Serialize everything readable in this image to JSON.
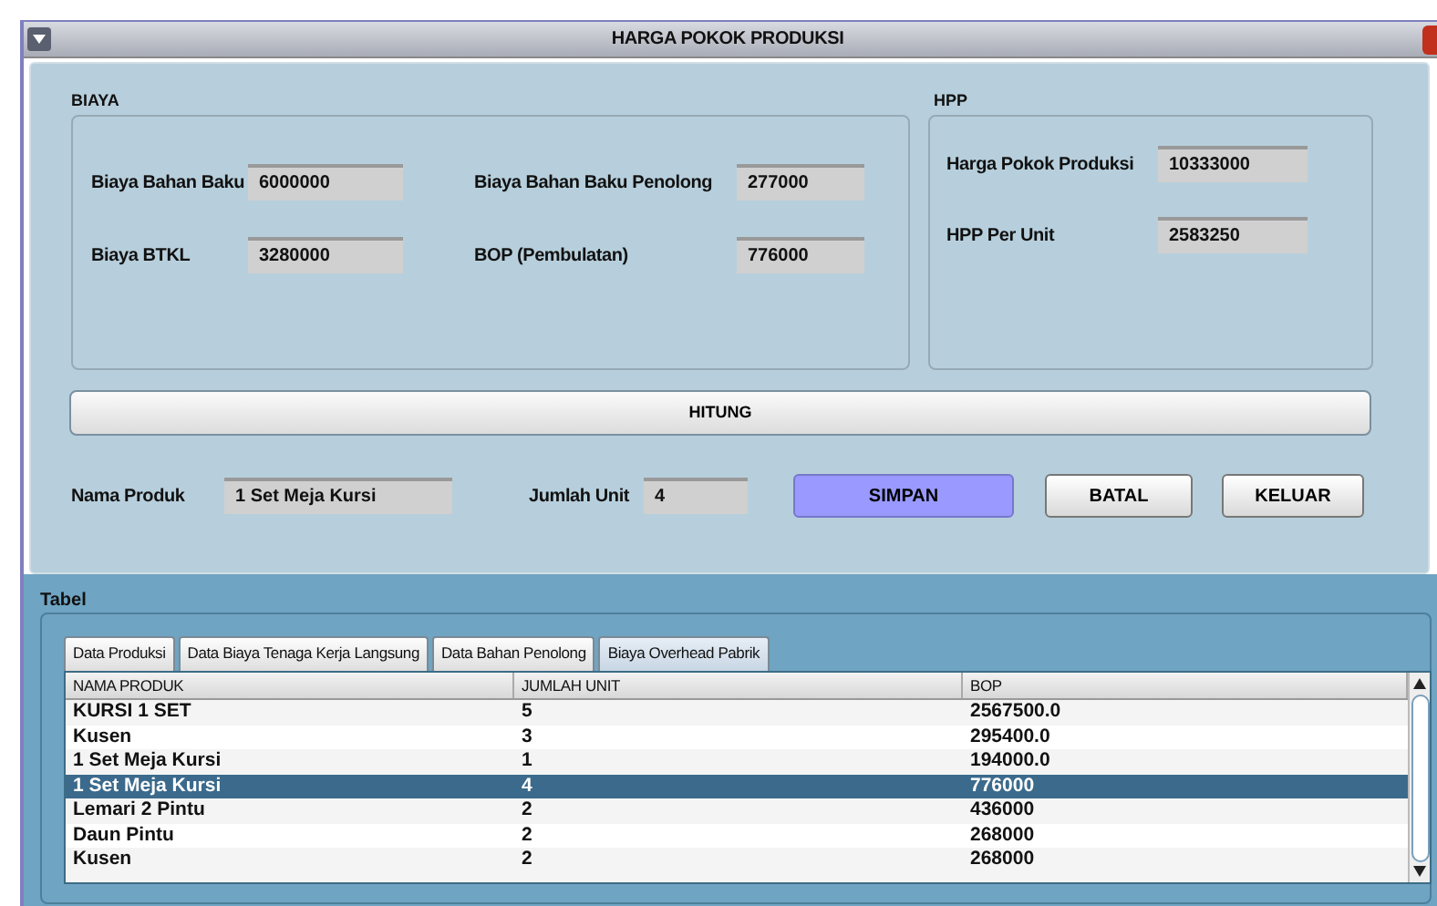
{
  "window": {
    "title": "HARGA POKOK PRODUKSI"
  },
  "biaya": {
    "title": "BIAYA",
    "fields": [
      {
        "label": "Biaya Bahan Baku",
        "value": "6000000"
      },
      {
        "label": "Biaya Bahan Baku Penolong",
        "value": "277000"
      },
      {
        "label": "Biaya BTKL",
        "value": "3280000"
      },
      {
        "label": "BOP (Pembulatan)",
        "value": "776000"
      }
    ]
  },
  "hpp": {
    "title": "HPP",
    "fields": [
      {
        "label": "Harga Pokok Produksi",
        "value": "10333000"
      },
      {
        "label": "HPP Per Unit",
        "value": "2583250"
      }
    ]
  },
  "hitung_button": "HITUNG",
  "product_fields": [
    {
      "label": "Nama Produk",
      "value": "1 Set Meja Kursi"
    },
    {
      "label": "Jumlah Unit",
      "value": "4"
    }
  ],
  "buttons": [
    {
      "label": "SIMPAN",
      "highlighted": true
    },
    {
      "label": "BATAL",
      "highlighted": false
    },
    {
      "label": "KELUAR",
      "highlighted": false
    }
  ],
  "table_panel": {
    "title": "Tabel",
    "tabs": [
      {
        "label": "Data Produksi",
        "selected": false
      },
      {
        "label": "Data Biaya Tenaga Kerja Langsung",
        "selected": false
      },
      {
        "label": "Data Bahan Penolong",
        "selected": false
      },
      {
        "label": "Biaya Overhead Pabrik",
        "selected": true
      }
    ],
    "table": {
      "columns": [
        "NAMA PRODUK",
        "JUMLAH UNIT",
        "BOP"
      ],
      "rows": [
        {
          "cells": [
            "KURSI 1 SET",
            "5",
            "2567500.0"
          ],
          "selected": false
        },
        {
          "cells": [
            "Kusen",
            "3",
            "295400.0"
          ],
          "selected": false
        },
        {
          "cells": [
            "1 Set Meja Kursi",
            "1",
            "194000.0"
          ],
          "selected": false
        },
        {
          "cells": [
            "1 Set Meja Kursi",
            "4",
            "776000"
          ],
          "selected": true
        },
        {
          "cells": [
            "Lemari 2 Pintu",
            "2",
            "436000"
          ],
          "selected": false
        },
        {
          "cells": [
            "Daun Pintu",
            "2",
            "268000"
          ],
          "selected": false
        },
        {
          "cells": [
            "Kusen",
            "2",
            "268000"
          ],
          "selected": false
        }
      ]
    }
  }
}
